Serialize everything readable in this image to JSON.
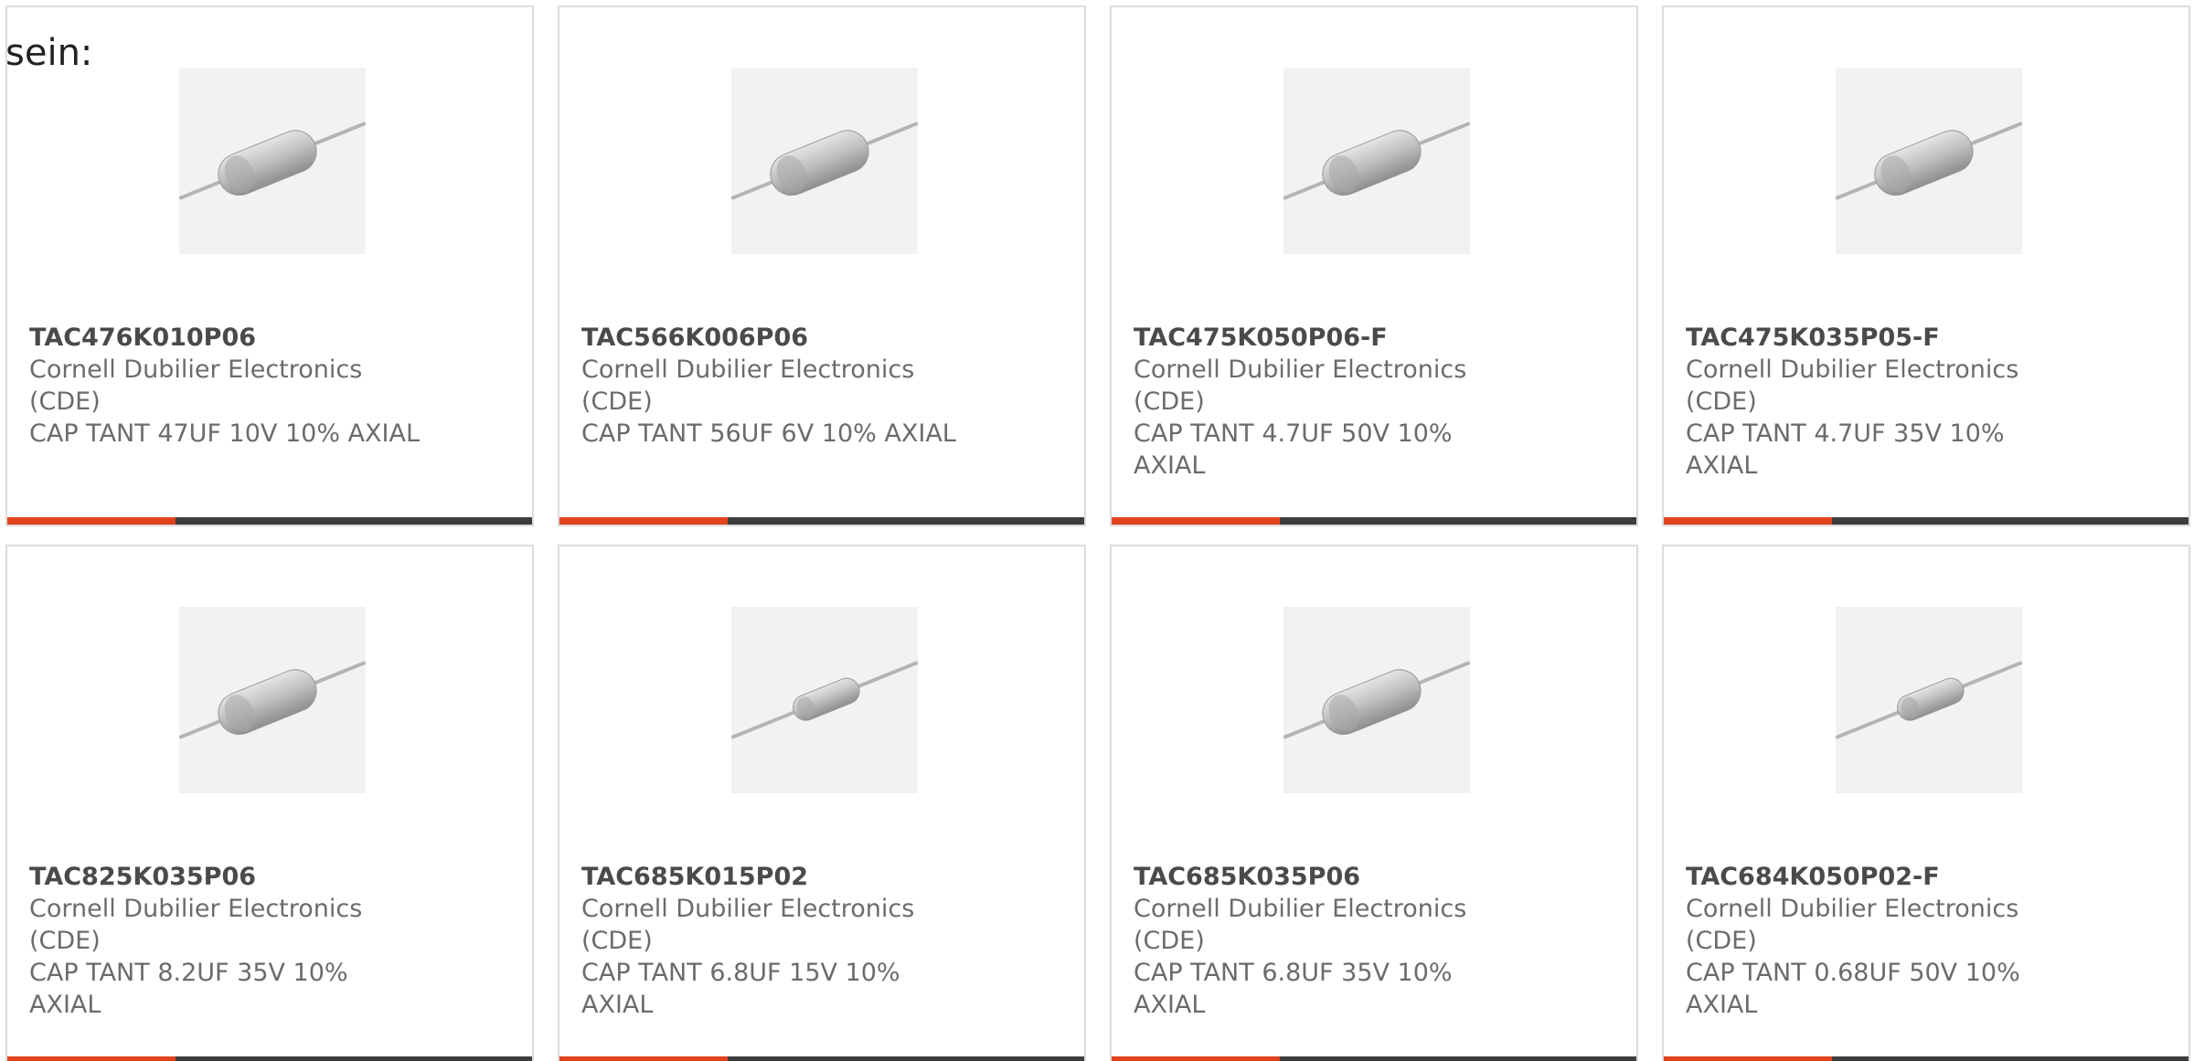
{
  "intro_text": "sein:",
  "colors": {
    "accent": "#e0421c",
    "bar": "#3d3d3d",
    "border": "#dcdcdc",
    "text": "#6b6b6b",
    "part_number": "#4a4a4a"
  },
  "products": [
    {
      "part_number": "TAC476K010P06",
      "manufacturer": "Cornell Dubilier Electronics (CDE)",
      "description": "CAP TANT 47UF 10V 10% AXIAL",
      "image_icon": "axial-capacitor-large-icon",
      "accent_fraction": 0.32
    },
    {
      "part_number": "TAC566K006P06",
      "manufacturer": "Cornell Dubilier Electronics (CDE)",
      "description": "CAP TANT 56UF 6V 10% AXIAL",
      "image_icon": "axial-capacitor-large-icon",
      "accent_fraction": 0.32
    },
    {
      "part_number": "TAC475K050P06-F",
      "manufacturer": "Cornell Dubilier Electronics (CDE)",
      "description": "CAP TANT 4.7UF 50V 10% AXIAL",
      "image_icon": "axial-capacitor-large-icon",
      "accent_fraction": 0.32
    },
    {
      "part_number": "TAC475K035P05-F",
      "manufacturer": "Cornell Dubilier Electronics (CDE)",
      "description": "CAP TANT 4.7UF 35V 10% AXIAL",
      "image_icon": "axial-capacitor-large-icon",
      "accent_fraction": 0.32
    },
    {
      "part_number": "TAC825K035P06",
      "manufacturer": "Cornell Dubilier Electronics (CDE)",
      "description": "CAP TANT 8.2UF 35V 10% AXIAL",
      "image_icon": "axial-capacitor-large-icon",
      "accent_fraction": 0.32
    },
    {
      "part_number": "TAC685K015P02",
      "manufacturer": "Cornell Dubilier Electronics (CDE)",
      "description": "CAP TANT 6.8UF 15V 10% AXIAL",
      "image_icon": "axial-capacitor-small-icon",
      "accent_fraction": 0.32
    },
    {
      "part_number": "TAC685K035P06",
      "manufacturer": "Cornell Dubilier Electronics (CDE)",
      "description": "CAP TANT 6.8UF 35V 10% AXIAL",
      "image_icon": "axial-capacitor-large-icon",
      "accent_fraction": 0.32
    },
    {
      "part_number": "TAC684K050P02-F",
      "manufacturer": "Cornell Dubilier Electronics (CDE)",
      "description": "CAP TANT 0.68UF 50V 10% AXIAL",
      "image_icon": "axial-capacitor-small-icon",
      "accent_fraction": 0.32
    }
  ]
}
